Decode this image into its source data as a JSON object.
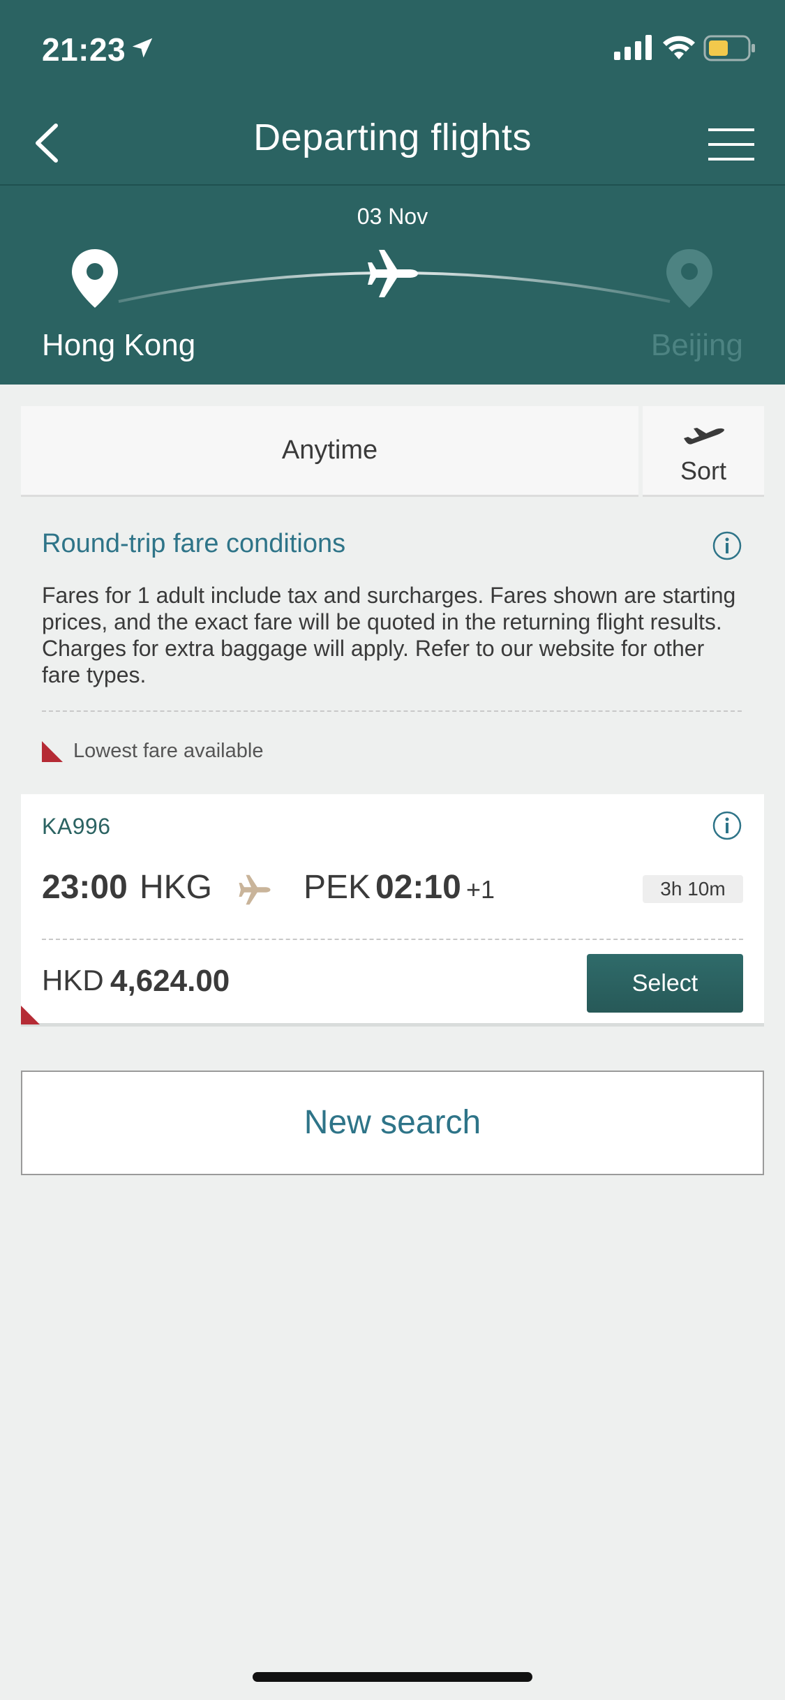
{
  "status_bar": {
    "time": "21:23"
  },
  "nav": {
    "title": "Departing flights"
  },
  "route": {
    "date": "03 Nov",
    "origin": "Hong Kong",
    "destination": "Beijing"
  },
  "filters": {
    "time_filter": "Anytime",
    "sort_label": "Sort"
  },
  "conditions": {
    "title": "Round-trip fare conditions",
    "text": "Fares for 1 adult include tax and surcharges. Fares shown are starting prices, and the exact fare will be quoted in the returning flight results. Charges for extra baggage will apply. Refer to our website for other fare types."
  },
  "legend": {
    "lowest_fare": "Lowest fare available"
  },
  "flights": [
    {
      "flight_number": "KA996",
      "departure_time": "23:00",
      "departure_code": "HKG",
      "arrival_code": "PEK",
      "arrival_time": "02:10",
      "day_offset": "+1",
      "duration": "3h 10m",
      "currency": "HKD",
      "price": "4,624.00",
      "select_label": "Select"
    }
  ],
  "new_search_label": "New search",
  "colors": {
    "header_bg": "#2b6362",
    "accent_link": "#2e7488",
    "lowest_fare_marker": "#b52b35",
    "select_button": "#2b6362"
  },
  "icons": [
    "location-arrow-icon",
    "signal-icon",
    "wifi-icon",
    "battery-icon",
    "back-icon",
    "menu-icon",
    "origin-pin-icon",
    "destination-pin-icon",
    "plane-icon",
    "takeoff-icon",
    "info-icon"
  ]
}
